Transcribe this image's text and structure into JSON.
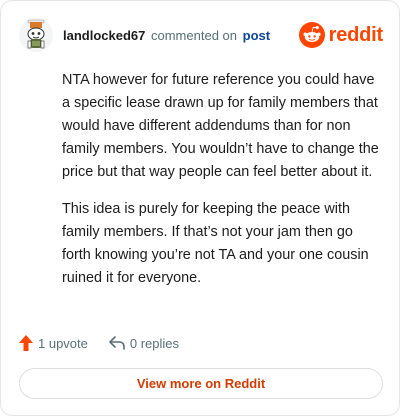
{
  "header": {
    "username": "landlocked67",
    "action": "commented on",
    "post_link": "post",
    "brand": "reddit",
    "avatar_icon": "snoo-avatar-icon",
    "brand_icon": "reddit-logo-icon"
  },
  "comment": {
    "paragraphs": [
      "NTA however for future reference you could have a specific lease drawn up for family members that would have different addendums than for non family members. You wouldn’t have to change the price but that way people can feel better about it.",
      "This idea is purely for keeping the peace with family members. If that’s not your jam then go forth knowing you’re not TA and your one cousin ruined it for everyone."
    ]
  },
  "footer": {
    "upvotes": "1 upvote",
    "replies": "0 replies",
    "upvote_icon": "upvote-arrow-icon",
    "reply_icon": "reply-arrow-icon"
  },
  "cta": {
    "label": "View more on Reddit"
  },
  "colors": {
    "brand": "#ff4500",
    "link": "#0a449b",
    "cta_text": "#d93a00",
    "upvote": "#ff4500"
  }
}
